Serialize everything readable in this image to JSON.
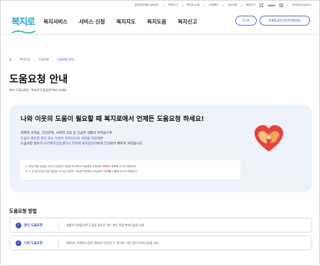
{
  "utility": {
    "links": [
      "공공안전포털 내보내기",
      "복지소식",
      "복지로 소개",
      "고객센터",
      "사이트맵",
      "화면크기"
    ],
    "zoom_minus": "-",
    "zoom_value": "100%",
    "zoom_plus": "+",
    "language": "외국인(English)"
  },
  "logo": {
    "text": "복지로"
  },
  "gnb": [
    "복지서비스",
    "서비스 신청",
    "복지지도",
    "복지도움",
    "복지신고"
  ],
  "auth": {
    "login": "로그인",
    "signup": "맞춤형급여안내(복지멤버십)"
  },
  "breadcrumb": {
    "home": "⌂",
    "items": [
      "복지도움",
      "도움요청",
      "도움요청 안내"
    ]
  },
  "page": {
    "title": "도움요청 안내",
    "description": "복지 도움요청은 '복지로'도움요청'에서 하세요."
  },
  "info": {
    "headline": "나와 이웃의 도움이 필요할 때 복지로에서 언제든 도움요청 하세요!",
    "line1": "경제적 어려움, 건강문제, 사회적 고립 등 긴급한 생활의 어려움으로",
    "line2_hl": "도움이 필요한 본인 또는 이웃이 온라인으로 사연을 작성",
    "line2_rest": "하면",
    "line3_a": "도움요청 정보가 ",
    "line3_hl": "보건복지상담센터나 지자체 복지담당자",
    "line3_b": "에게 ",
    "line3_c": "전달",
    "line3_d": "되어 빠르게 처리됩니다.",
    "notice1_a": "※ 자살 관련 상담은 24시간 상담이 가능한 보건복지 자살예방 상담센터 ",
    "notice1_red": "109",
    "notice1_b": "로 전화해 주시기 바랍니다.",
    "notice2_a": "※ 그 외 정신건강 관련 상담은 24시간 상담이 가능한 보건복지 상담센터 ",
    "notice2_red": "129",
    "notice2_b": "를 이용해 주시기 바랍니다."
  },
  "method": {
    "title": "도움요청 방법",
    "rows": [
      {
        "check": "✓",
        "label": "본인 도움요청",
        "desc": "생활의 어려움으로 도움을 필요로 하는 본인 직접 복지도움을 요청"
      },
      {
        "check": "✓",
        "label": "이웃 도움요청",
        "desc": "제3자가 주변에 도움이 필요한 이웃(친구, 친인척, 지인 등)의 복지도움을 요청"
      }
    ]
  },
  "colors": {
    "accent": "#3a4fd6",
    "panel": "#eef2fa",
    "alert": "#e2453a",
    "logo": "#1fa3c9"
  }
}
